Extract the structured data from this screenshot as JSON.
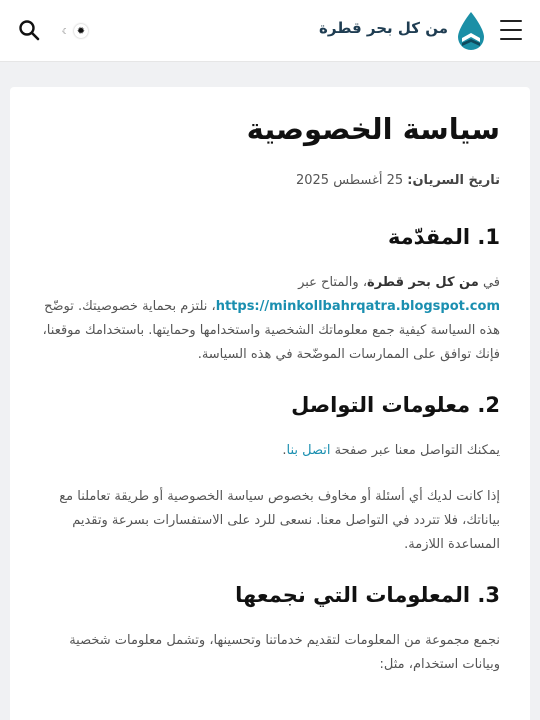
{
  "header": {
    "site_name": "من كل بحر قطرة"
  },
  "article": {
    "title": "سياسة الخصوصية",
    "effective_label": "تاريخ السريان:",
    "effective_date": "25 أغسطس 2025",
    "sections": [
      {
        "heading": "1. المقدّمة",
        "p1_prefix": "في",
        "site_name": "من كل بحر قطرة",
        "p1_mid": "، والمتاح عبر",
        "url": "https://minkollbahrqatra.blogspot.com",
        "p1_rest": "، نلتزم بحماية خصوصيتك. توضّح هذه السياسة كيفية جمع معلوماتك الشخصية واستخدامها وحمايتها. باستخدامك موقعنا، فإنك توافق على الممارسات الموضّحة في هذه السياسة."
      },
      {
        "heading": "2. معلومات التواصل",
        "p1_prefix": "يمكنك التواصل معنا عبر صفحة",
        "link": "اتصل بنا",
        "p1_suffix": ".",
        "p2": "إذا كانت لديك أي أسئلة أو مخاوف بخصوص سياسة الخصوصية أو طريقة تعاملنا مع بياناتك، فلا تتردد في التواصل معنا. نسعى للرد على الاستفسارات بسرعة وتقديم المساعدة اللازمة."
      },
      {
        "heading": "3. المعلومات التي نجمعها",
        "p1": "نجمع مجموعة من المعلومات لتقديم خدماتنا وتحسينها، وتشمل معلومات شخصية وبيانات استخدام، مثل:"
      }
    ]
  },
  "colors": {
    "accent": "#1a8fb0",
    "brand_dark": "#1f3d52",
    "page_bg": "#f0f1f3"
  }
}
